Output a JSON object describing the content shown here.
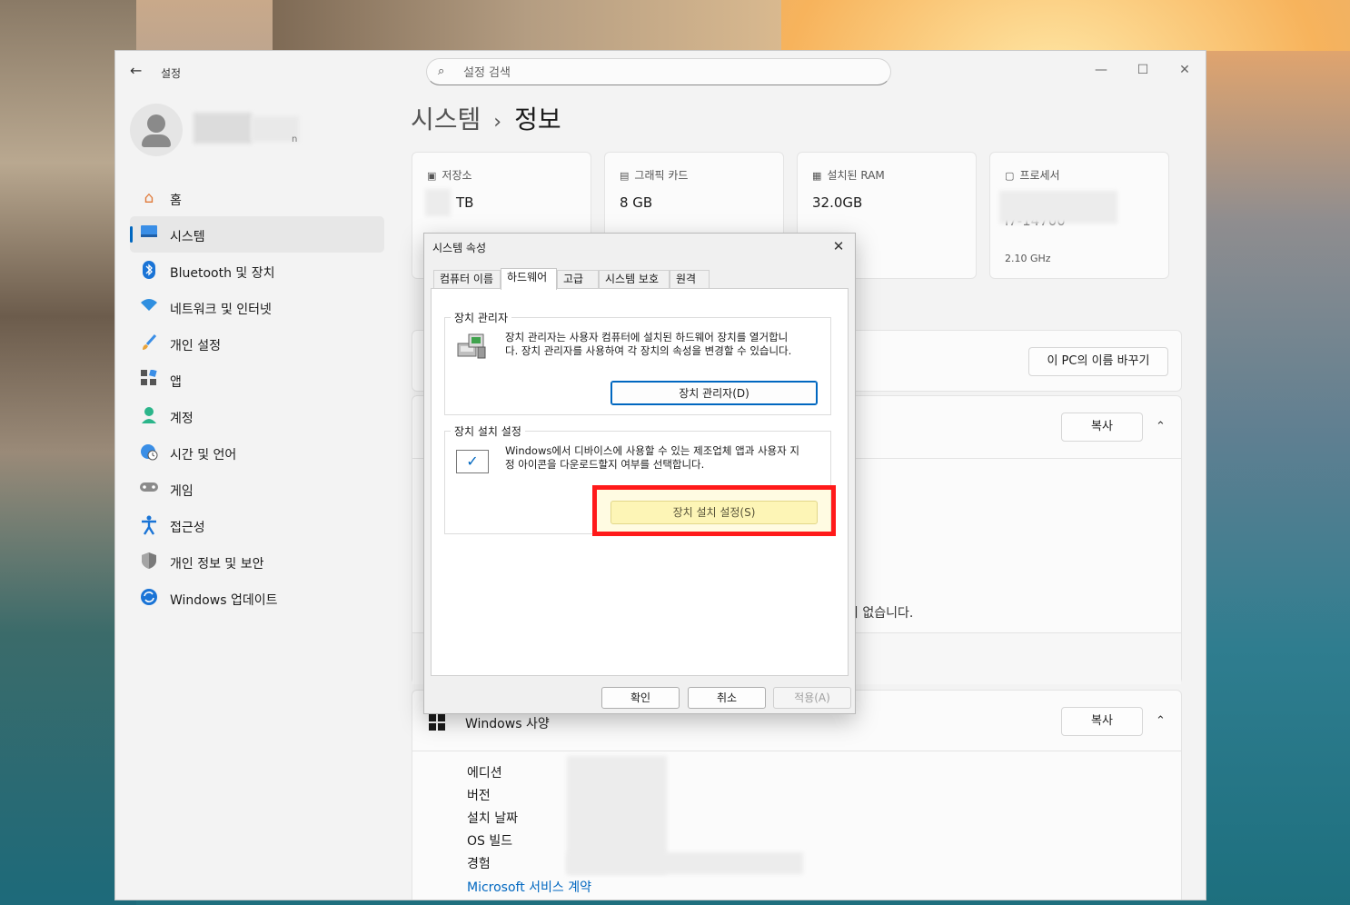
{
  "settings": {
    "app_title": "설정",
    "search_placeholder": "설정 검색",
    "window_controls": {
      "minimize": "—",
      "maximize": "☐",
      "close": "✕"
    },
    "profile": {
      "name_suffix": "n"
    },
    "nav": [
      {
        "label": "홈",
        "icon": "home-icon"
      },
      {
        "label": "시스템",
        "icon": "system-icon",
        "active": true
      },
      {
        "label": "Bluetooth 및 장치",
        "icon": "bluetooth-icon"
      },
      {
        "label": "네트워크 및 인터넷",
        "icon": "wifi-icon"
      },
      {
        "label": "개인 설정",
        "icon": "brush-icon"
      },
      {
        "label": "앱",
        "icon": "apps-icon"
      },
      {
        "label": "계정",
        "icon": "account-icon"
      },
      {
        "label": "시간 및 언어",
        "icon": "globe-clock-icon"
      },
      {
        "label": "게임",
        "icon": "gamepad-icon"
      },
      {
        "label": "접근성",
        "icon": "accessibility-icon"
      },
      {
        "label": "개인 정보 및 보안",
        "icon": "shield-icon"
      },
      {
        "label": "Windows 업데이트",
        "icon": "update-icon"
      }
    ],
    "breadcrumb": {
      "parent": "시스템",
      "separator": "›",
      "current": "정보"
    },
    "cards": [
      {
        "label": "저장소",
        "value": "TB",
        "icon": "storage-icon"
      },
      {
        "label": "그래픽 카드",
        "value": "8 GB",
        "icon": "gpu-icon"
      },
      {
        "label": "설치된 RAM",
        "value": "32.0GB",
        "icon": "ram-icon"
      },
      {
        "label": "프로세서",
        "value": "i7-14700",
        "sub": "2.10 GHz",
        "icon": "cpu-icon"
      }
    ],
    "rename_button": "이 PC의 이름 바꾸기",
    "copy_button": "복사",
    "no_pen_text": "이 없습니다.",
    "windows_spec": {
      "title": "Windows 사양",
      "rows": [
        "에디션",
        "버전",
        "설치 날짜",
        "OS 빌드",
        "경험"
      ],
      "link": "Microsoft 서비스 계약"
    }
  },
  "dialog": {
    "title": "시스템 속성",
    "close": "✕",
    "tabs": [
      "컴퓨터 이름",
      "하드웨어",
      "고급",
      "시스템 보호",
      "원격"
    ],
    "active_tab": 1,
    "device_manager": {
      "title": "장치 관리자",
      "text": "장치 관리자는 사용자 컴퓨터에 설치된 하드웨어 장치를 열거합니다. 장치 관리자를 사용하여 각 장치의 속성을 변경할 수 있습니다.",
      "button": "장치 관리자(D)"
    },
    "device_install": {
      "title": "장치 설치 설정",
      "text": "Windows에서 디바이스에 사용할 수 있는 제조업체 앱과 사용자 지정 아이콘을 다운로드할지 여부를 선택합니다.",
      "button": "장치 설치 설정(S)"
    },
    "buttons": {
      "ok": "확인",
      "cancel": "취소",
      "apply": "적용(A)"
    }
  },
  "colors": {
    "accent": "#0067c0",
    "highlight": "#ff1a1a"
  }
}
